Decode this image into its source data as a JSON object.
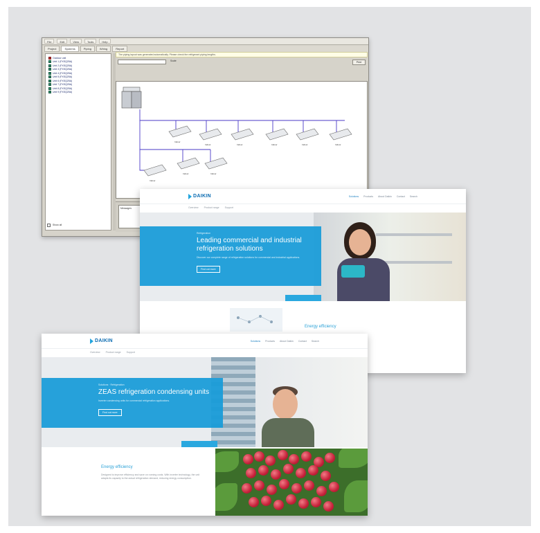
{
  "software": {
    "menu": [
      "File",
      "Edit",
      "View",
      "Tools",
      "Help"
    ],
    "tabs": [
      "Project",
      "Systems",
      "Piping",
      "Wiring",
      "Report"
    ],
    "tree_items": [
      "Outdoor unit",
      "Unit 1 (FXSQ25A)",
      "Unit 2 (FXSQ25A)",
      "Unit 3 (FXSQ25A)",
      "Unit 4 (FXSQ25A)",
      "Unit 5 (FXSQ25A)",
      "Unit 6 (FXSQ25A)",
      "Unit 7 (FXSQ25A)",
      "Unit 8 (FXSQ25A)",
      "Unit 9 (FXSQ25A)"
    ],
    "tree_footer": "Show all",
    "info_text": "The piping layout was generated automatically. Please check the refrigerant piping lengths.",
    "scale_label": "Scale",
    "button_label": "Print",
    "unit_label": "Indoor",
    "bottom_label": "Messages"
  },
  "web1": {
    "logo": "DAIKIN",
    "nav": [
      "Solutions",
      "Products",
      "About Daikin",
      "Contact",
      "Search"
    ],
    "subnav": [
      "Overview",
      "Product range",
      "Support"
    ],
    "crumb": "Refrigeration",
    "title": "Leading commercial and industrial refrigeration solutions",
    "text": "Discover our complete range of refrigeration solutions for commercial and industrial applications.",
    "button": "Find out more",
    "section_title": "Energy efficiency"
  },
  "web2": {
    "logo": "DAIKIN",
    "nav": [
      "Solutions",
      "Products",
      "About Daikin",
      "Contact",
      "Search"
    ],
    "subnav": [
      "Overview",
      "Product range",
      "Support"
    ],
    "crumb": "Solutions · Refrigeration",
    "title": "ZEAS refrigeration condensing units",
    "text": "Inverter condensing units for commercial refrigeration applications.",
    "button": "Find out more",
    "section_title": "Energy efficiency",
    "section_text": "Designed to improve efficiency and save on running costs. With inverter technology, the unit adapts its capacity to the actual refrigeration demand, reducing energy consumption."
  },
  "colors": {
    "daikin_blue": "#1b9cd9",
    "background": "#e2e3e5"
  }
}
